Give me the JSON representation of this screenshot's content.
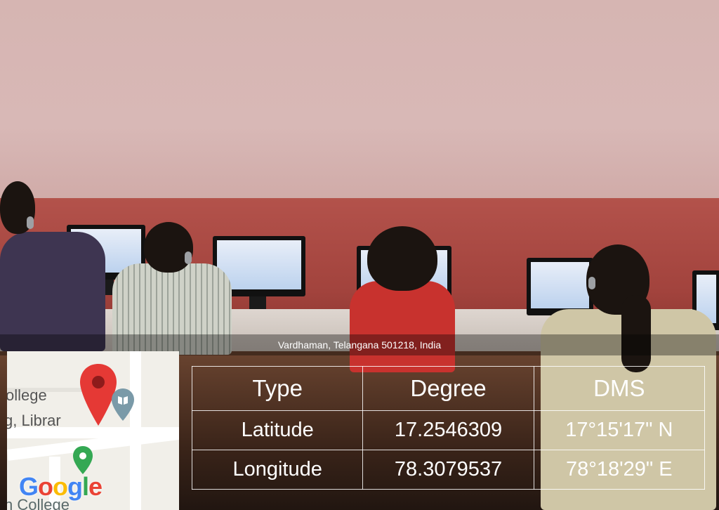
{
  "photo": {
    "description_icon": "photo-background"
  },
  "overlay": {
    "address": "Vardhaman, Telangana 501218, India"
  },
  "map": {
    "labels": [
      "ollege",
      "g, Librar",
      "n College"
    ],
    "pin_icon": "red-location-pin-icon",
    "library_icon": "library-pin-icon",
    "green_pin_icon": "green-location-pin-icon",
    "logo": "Google"
  },
  "table": {
    "headers": [
      "Type",
      "Degree",
      "DMS"
    ],
    "rows": [
      [
        "Latitude",
        "17.2546309",
        "17°15'17\" N"
      ],
      [
        "Longitude",
        "78.3079537",
        "78°18'29\" E"
      ]
    ]
  }
}
